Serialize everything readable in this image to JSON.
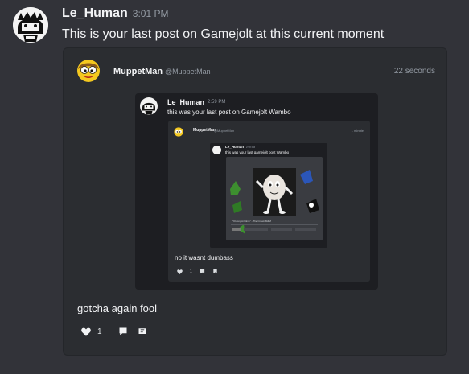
{
  "message": {
    "author": "Le_Human",
    "timestamp": "3:01 PM",
    "text": "This is your last post on Gamejolt at this current moment"
  },
  "embed": {
    "author": "MuppetMan",
    "handle": "@MuppetMan",
    "time": "22 seconds",
    "screenshot": {
      "author": "Le_Human",
      "timestamp": "2:59 PM",
      "text": "this was your last post on Gamejolt Wambo",
      "inner_embed": {
        "author": "MuppetMan",
        "handle": "@MuppetMan",
        "time": "1 minute",
        "nested": {
          "author": "Le_Human",
          "timestamp": "2:58 PM",
          "text": "this was your last gamejolt post Wambo",
          "caption": "\"It's ongoin' time\" - The Crown M&M"
        },
        "reply_text": "no it wasnt dumbass",
        "like_count": "1"
      }
    },
    "reply_text": "gotcha again fool",
    "like_count": "1"
  },
  "icons": {
    "like": "heart-icon",
    "comment": "comment-icon",
    "share": "share-icon"
  },
  "colors": {
    "background": "#323339",
    "embed_bg": "#2b2d31",
    "text": "#f2f3f5",
    "muted": "#949ba4"
  }
}
